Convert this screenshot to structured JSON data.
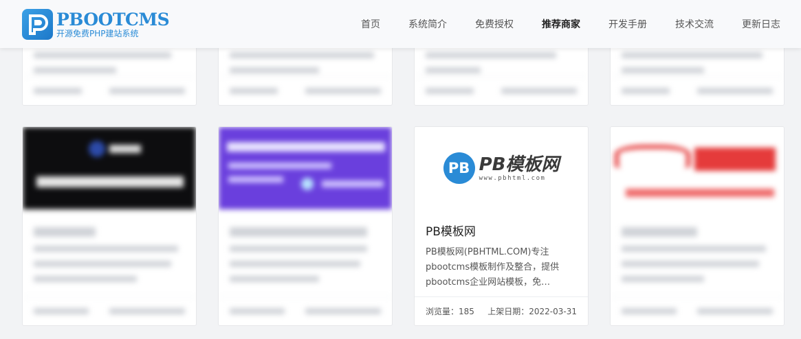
{
  "header": {
    "logo_name": "PBOOTCMS",
    "logo_sub": "开源免费PHP建站系统",
    "nav": [
      "首页",
      "系统简介",
      "免费授权",
      "推荐商家",
      "开发手册",
      "技术交流",
      "更新日志"
    ],
    "active_index": 3
  },
  "featured": {
    "logo_title": "PB模板网",
    "logo_url": "www.pbhtml.com",
    "title": "PB模板网",
    "desc": "PB模板网(PBHTML.COM)专注pbootcms模板制作及整合，提供pbootcms企业网站模板，免…",
    "views_label": "浏览量：185",
    "date_label": "上架日期：2022-03-31"
  },
  "colors": {
    "brand": "#2a8bd6",
    "purple_banner": "#6a3fdd",
    "red_banner": "#e53b3b"
  }
}
